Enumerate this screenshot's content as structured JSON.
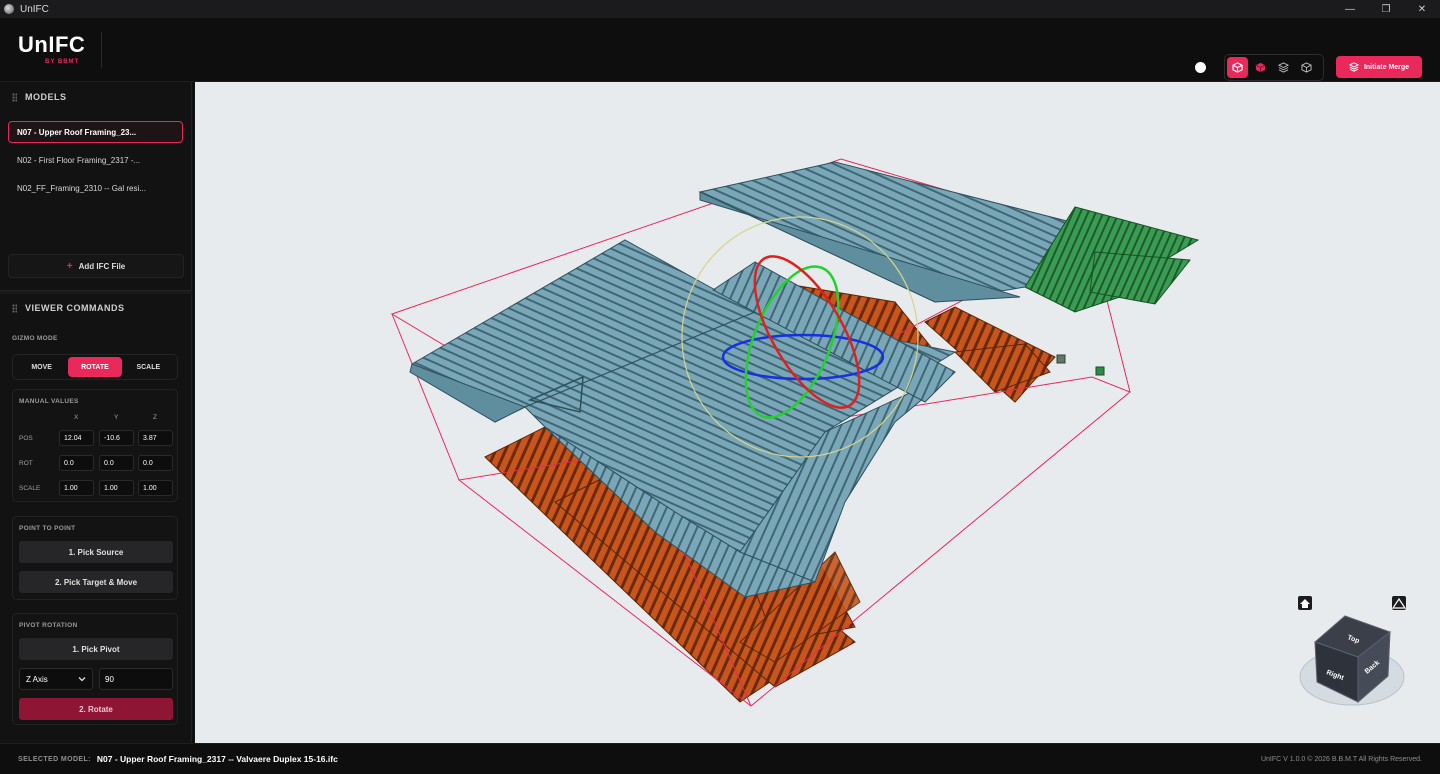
{
  "window": {
    "title": "UnIFC",
    "controls": [
      "—",
      "❐",
      "✕"
    ]
  },
  "header": {
    "logo_name": "UnIFC",
    "logo_by": "BY BBMT",
    "merge_label": "Initiate Merge",
    "view_modes": [
      "solid-cube-icon",
      "red-cube-icon",
      "layers-icon",
      "wire-cube-icon"
    ],
    "active_view_mode": 0
  },
  "models": {
    "title": "MODELS",
    "items": [
      {
        "label": "N07 - Upper Roof Framing_23...",
        "active": true
      },
      {
        "label": "N02 - First Floor Framing_2317 -...",
        "active": false
      },
      {
        "label": "N02_FF_Framing_2310 -- Gal resi...",
        "active": false
      }
    ],
    "add_label": "Add IFC File"
  },
  "commands": {
    "title": "VIEWER COMMANDS",
    "gizmo_label": "GIZMO MODE",
    "gizmo_modes": [
      "MOVE",
      "ROTATE",
      "SCALE"
    ],
    "active_gizmo": "ROTATE",
    "manual": {
      "title": "MANUAL VALUES",
      "axes": [
        "X",
        "Y",
        "Z"
      ],
      "rows": [
        {
          "label": "POS",
          "values": [
            "12.04",
            "-10.6",
            "3.87"
          ]
        },
        {
          "label": "ROT",
          "values": [
            "0.0",
            "0.0",
            "0.0"
          ]
        },
        {
          "label": "SCALE",
          "values": [
            "1.00",
            "1.00",
            "1.00"
          ]
        }
      ]
    },
    "p2p": {
      "title": "POINT TO POINT",
      "pick_source": "1. Pick Source",
      "pick_target": "2. Pick Target & Move"
    },
    "pivot": {
      "title": "PIVOT ROTATION",
      "pick_pivot": "1. Pick Pivot",
      "axis": "Z Axis",
      "angle": "90",
      "rotate": "2. Rotate"
    }
  },
  "viewcube": {
    "faces": [
      "Top",
      "Right",
      "Back"
    ]
  },
  "status": {
    "label": "SELECTED MODEL:",
    "model": "N07 - Upper Roof Framing_2317 -- Valvaere Duplex 15-16.ifc",
    "version": "UnIFC V 1.0.0  ©  2026 B.B.M.T All Rights Reserved."
  },
  "colors": {
    "accent": "#e8295a",
    "roof": "#6f9fb2",
    "floor": "#c4551c",
    "green": "#2e8a44",
    "bbox": "#e8295a"
  }
}
